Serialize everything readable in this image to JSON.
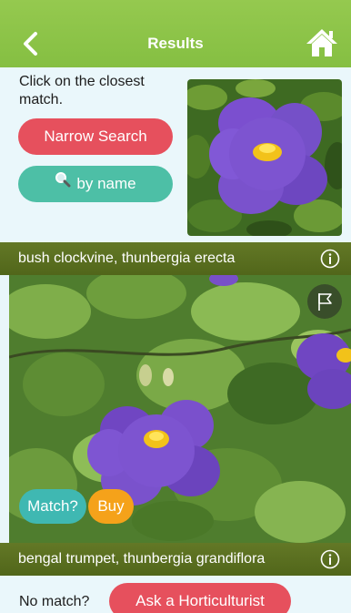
{
  "header": {
    "title": "Results",
    "back_icon": "chevron-left-icon",
    "home_icon": "home-icon",
    "color": "#8cc34a"
  },
  "top_panel": {
    "instructions": "Click on the closest match.",
    "narrow_search_label": "Narrow Search",
    "by_name_label": "by name",
    "by_name_icon": "magnifier-icon",
    "photo": "purple-flower-photo"
  },
  "results": [
    {
      "name": "bush clockvine, thunbergia erecta",
      "info_icon": "info-icon",
      "flag_icon": "flag-icon",
      "match_label": "Match?",
      "buy_label": "Buy"
    },
    {
      "name": "bengal trumpet, thunbergia grandiflora",
      "info_icon": "info-icon"
    }
  ],
  "bottom": {
    "no_match_label": "No match?",
    "ask_label": "Ask a Horticulturist"
  },
  "colors": {
    "accent_red": "#e6505d",
    "accent_teal": "#4dbfa6",
    "buy_orange": "#f5a21a",
    "result_bar": "#5a6e1f"
  }
}
